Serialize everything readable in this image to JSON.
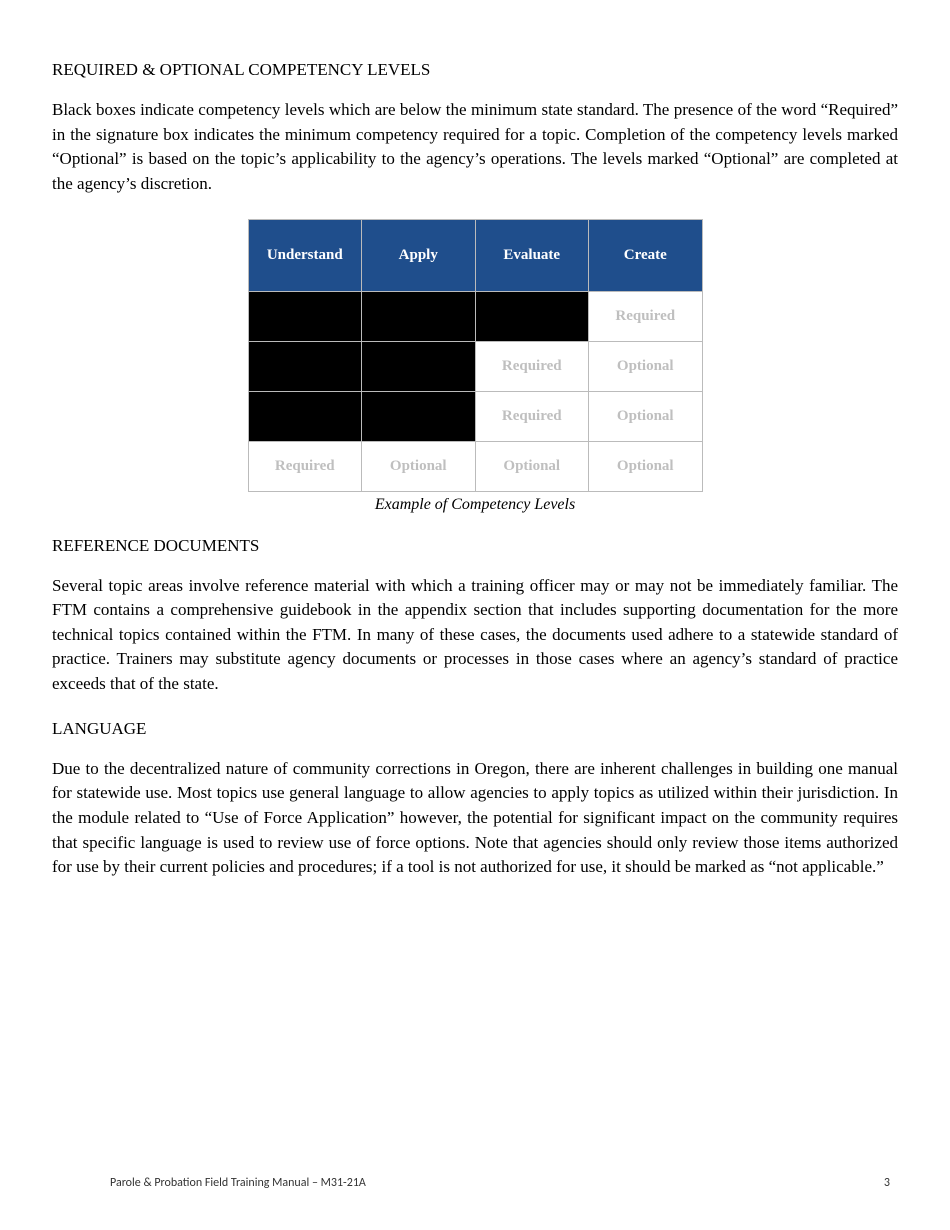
{
  "section1": {
    "heading": "REQUIRED & OPTIONAL COMPETENCY LEVELS",
    "body": "Black boxes indicate competency levels which are below the minimum state standard. The presence of the word “Required” in the signature box indicates the minimum competency required for a topic. Completion of the competency levels marked “Optional” is based on the topic’s applicability to the agency’s operations. The levels marked “Optional” are completed at the agency’s discretion."
  },
  "chart_data": {
    "type": "table",
    "headers": [
      "Understand",
      "Apply",
      "Evaluate",
      "Create"
    ],
    "rows": [
      [
        "black",
        "black",
        "black",
        "Required"
      ],
      [
        "black",
        "black",
        "Required",
        "Optional"
      ],
      [
        "black",
        "black",
        "Required",
        "Optional"
      ],
      [
        "Required",
        "Optional",
        "Optional",
        "Optional"
      ]
    ],
    "caption": "Example of Competency Levels"
  },
  "section2": {
    "heading": "REFERENCE DOCUMENTS",
    "body": "Several topic areas involve reference material with which a training officer may or may not be immediately familiar. The FTM contains a comprehensive guidebook in the appendix section that includes supporting documentation for the more technical topics contained within the FTM. In many of these cases, the documents used adhere to a statewide standard of practice. Trainers may substitute agency documents or processes in those cases where an agency’s standard of practice exceeds that of the state."
  },
  "section3": {
    "heading": "LANGUAGE",
    "body": "Due to the decentralized nature of community corrections in Oregon, there are inherent challenges in building one manual for statewide use. Most topics use general language to allow agencies to apply topics as utilized within their jurisdiction. In the module related to “Use of Force Application” however, the potential for significant impact on the community requires that specific language is used to review use of force options. Note that agencies should only review those items authorized for use by their current policies and procedures; if a tool is not authorized for use, it should be marked as “not applicable.”"
  },
  "footer": {
    "left": "Parole & Probation Field Training Manual – M31-21A",
    "right": "3"
  }
}
